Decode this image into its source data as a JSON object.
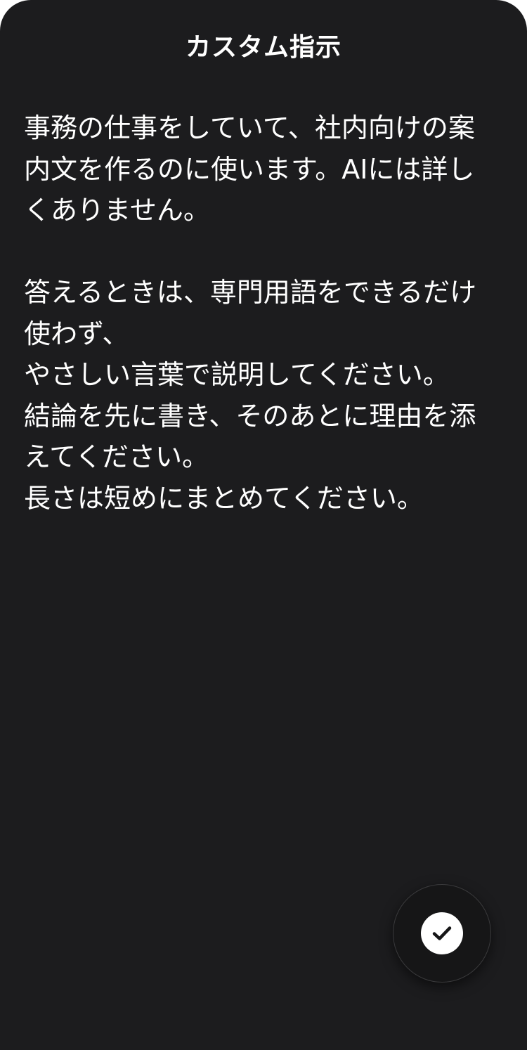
{
  "sheet": {
    "title": "カスタム指示",
    "instructions": "事務の仕事をしていて、社内向けの案内文を作るのに使います。AIには詳しくありません。\n\n答えるときは、専門用語をできるだけ使わず、\nやさしい言葉で説明してください。\n結論を先に書き、そのあとに理由を添えてください。\n長さは短めにまとめてください。"
  },
  "done_button": {
    "icon": "checkmark-icon"
  },
  "colors": {
    "background": "#1c1c1e",
    "text": "#ffffff",
    "button_background": "#161617",
    "button_border": "#3a3a3c",
    "check_circle": "#ffffff"
  }
}
